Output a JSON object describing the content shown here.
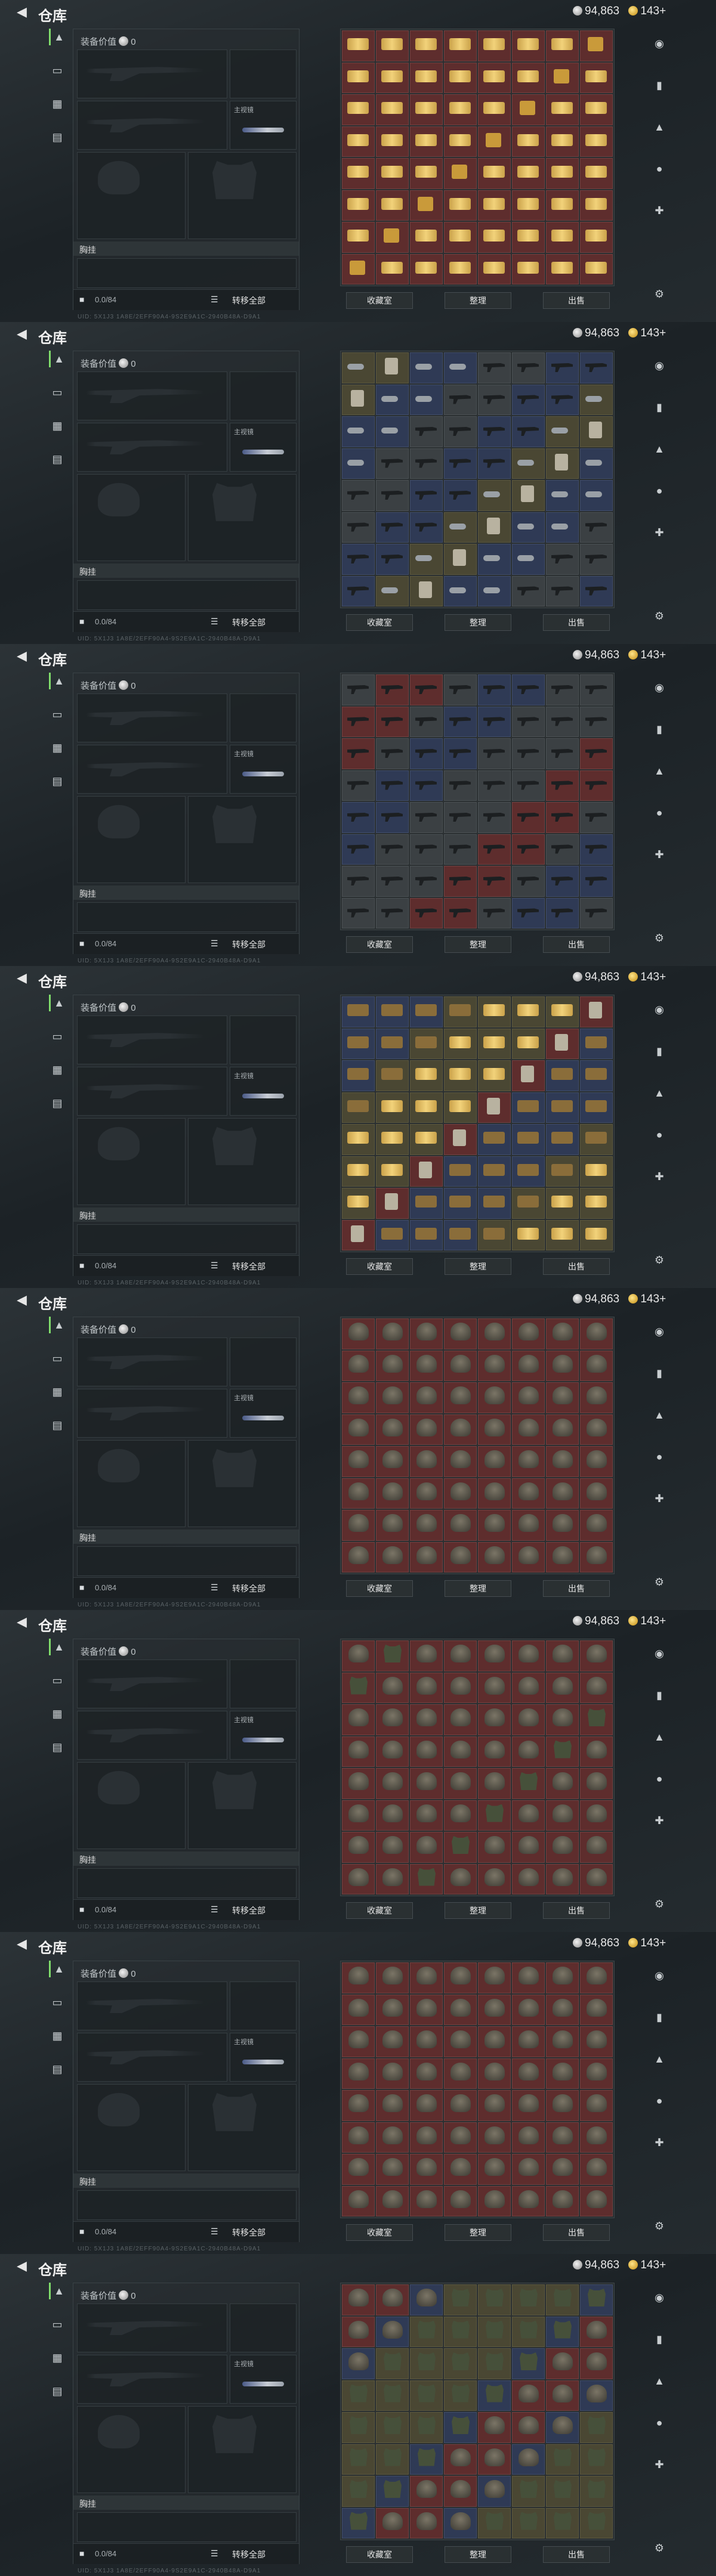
{
  "topbar": {
    "title": "仓库",
    "silver": "94,863",
    "gold": "143+"
  },
  "loadout": {
    "value_label": "装备价值",
    "value": "0",
    "chest": "胸挂",
    "capacity": "0.0/84",
    "transfer": "转移全部",
    "slot_label": "主视镜"
  },
  "actions": {
    "collection": "收藏室",
    "sort": "整理",
    "exit": "出售"
  },
  "footer": "UID:  5X1J3 1A8E/2EFF90A4-9S2E9A1C-2940B48A-D9A1",
  "screens": [
    {
      "cells": [
        "red:ammo",
        "red:ammo",
        "red:ammo",
        "red:ammo",
        "red:ammo",
        "red:ammo",
        "red:ammo",
        "red:gold"
      ]
    },
    {
      "cells": [
        "olive:key",
        "olive:med",
        "blue:key",
        "blue:key",
        "gray:gun",
        "gray:gun",
        "blue:gun",
        "blue:gun"
      ]
    },
    {
      "cells": [
        "gray:gun",
        "red:gun",
        "red:gun",
        "gray:gun",
        "blue:gun",
        "blue:gun",
        "gray:gun",
        "gray:gun"
      ]
    },
    {
      "cells": [
        "blue:box",
        "blue:box",
        "blue:box",
        "olive:box",
        "olive:ammo",
        "olive:ammo",
        "olive:ammo",
        "red:med"
      ]
    },
    {
      "cells": [
        "red:helm",
        "red:helm",
        "red:helm",
        "red:helm",
        "red:helm",
        "red:helm",
        "red:helm",
        "red:helm"
      ]
    },
    {
      "cells": [
        "red:helm",
        "red:vest",
        "red:helm",
        "red:helm",
        "red:helm",
        "red:helm",
        "red:helm",
        "red:helm"
      ]
    },
    {
      "cells": [
        "red:helm",
        "red:helm",
        "red:helm",
        "red:helm",
        "red:helm",
        "red:helm",
        "red:helm",
        "red:helm"
      ]
    },
    {
      "cells": [
        "red:helm",
        "red:helm",
        "blue:helm",
        "olive:vest",
        "olive:vest",
        "olive:vest",
        "olive:vest",
        "blue:vest"
      ]
    }
  ]
}
